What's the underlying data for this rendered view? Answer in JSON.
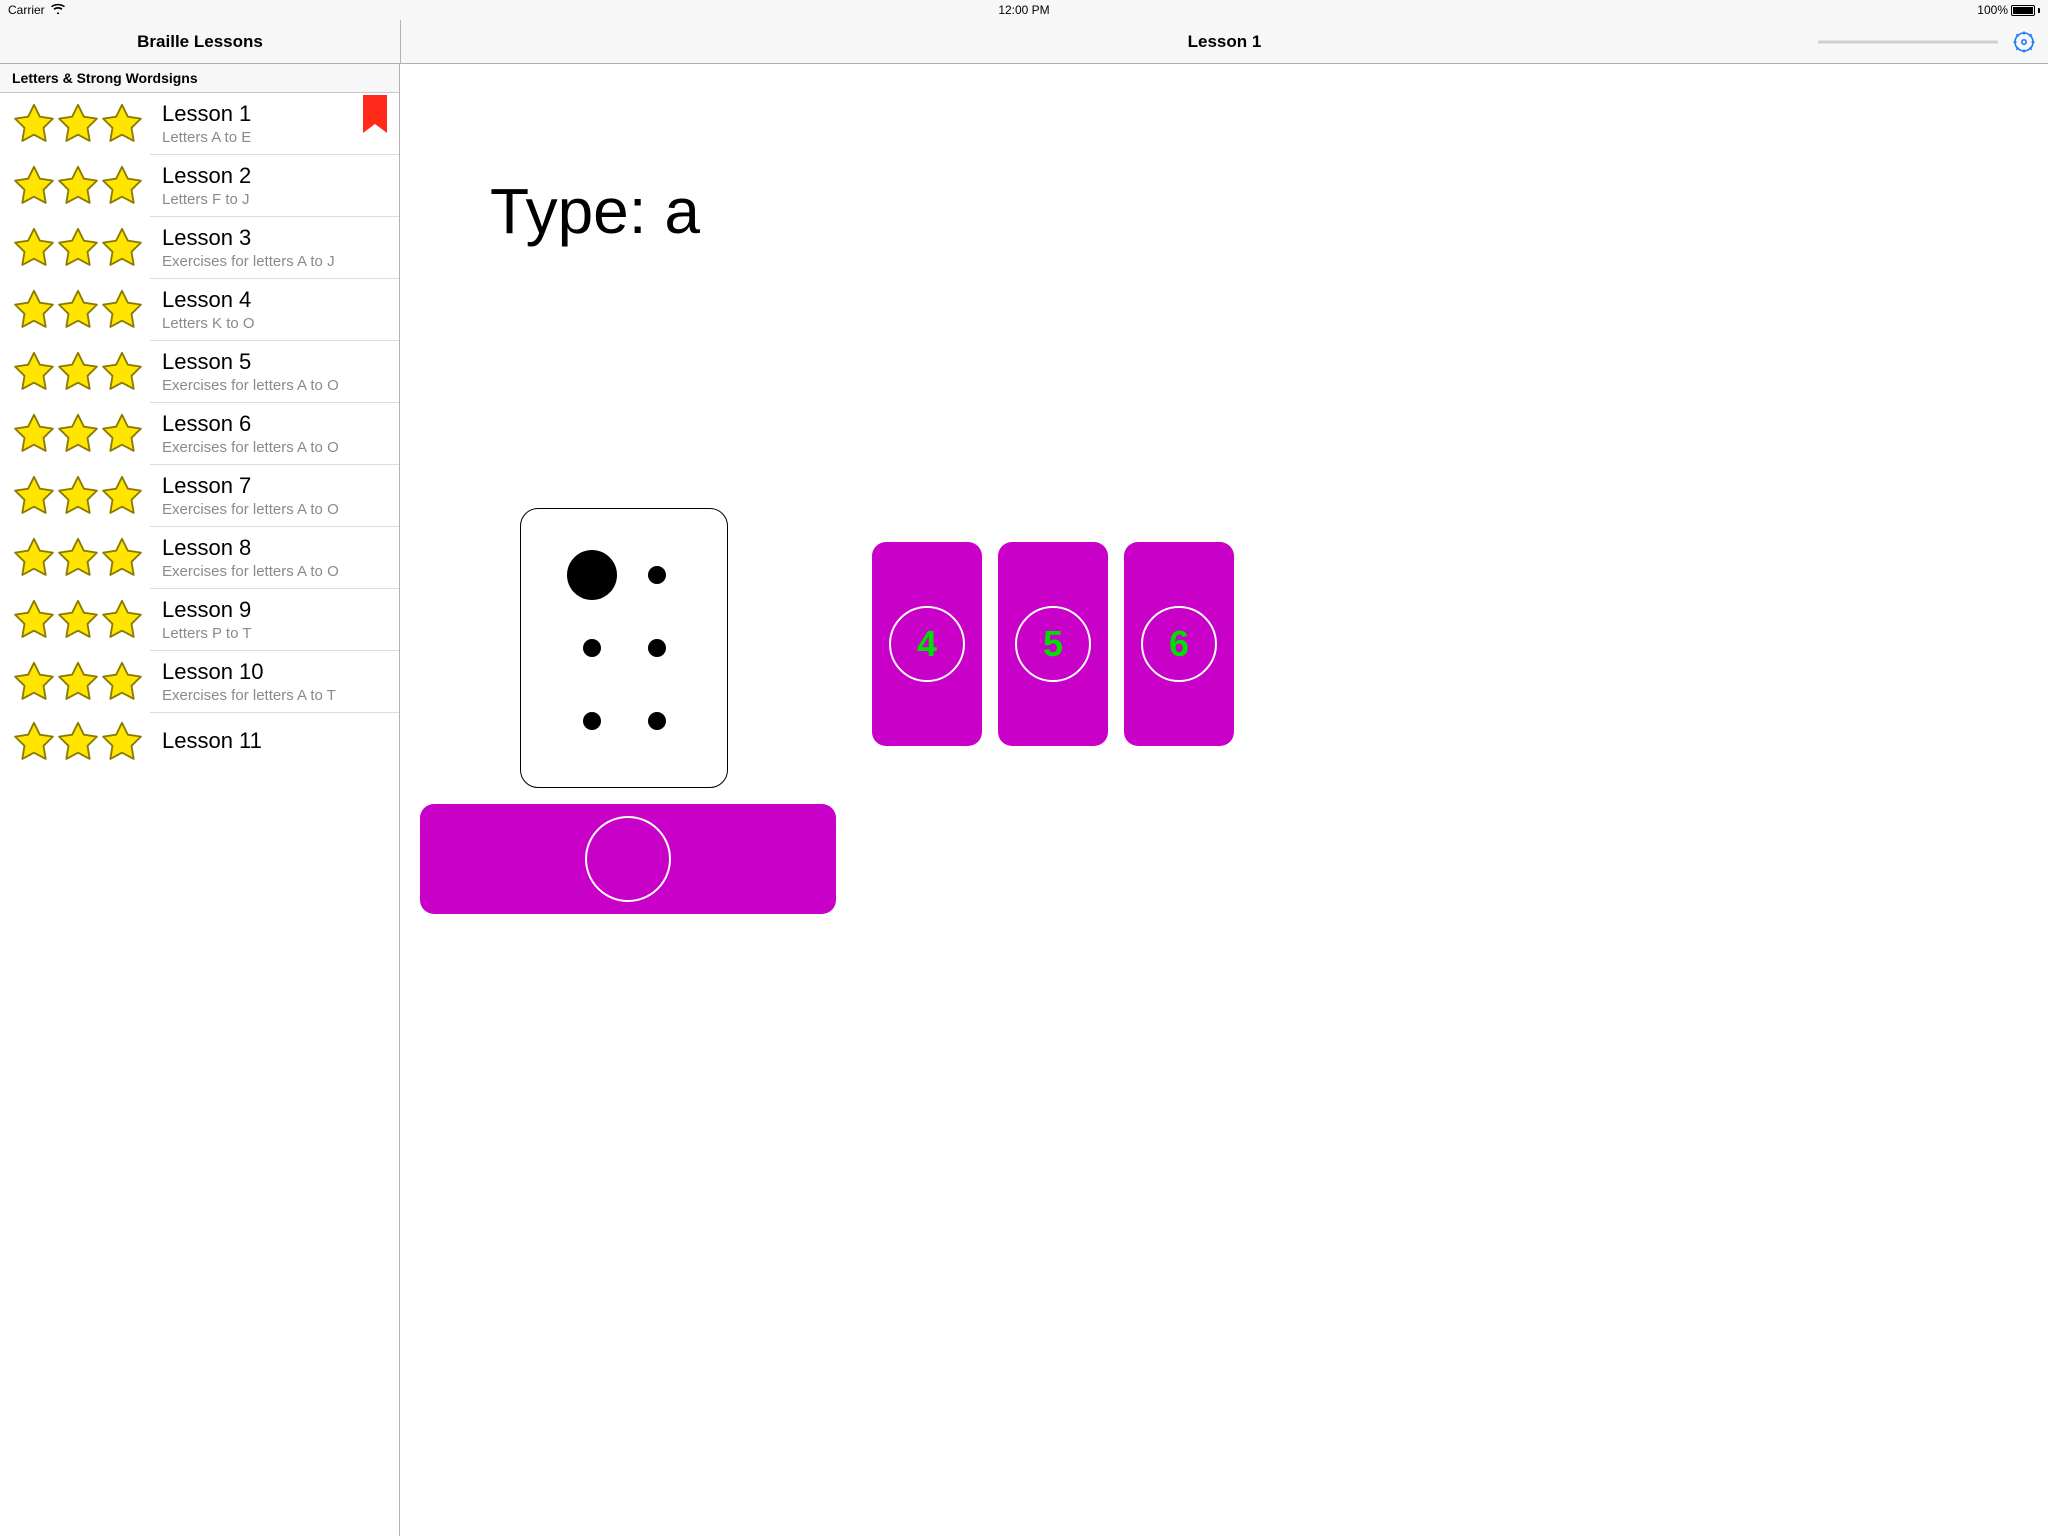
{
  "status": {
    "carrier": "Carrier",
    "time": "12:00 PM",
    "battery_pct": "100%"
  },
  "nav": {
    "sidebar_title": "Braille Lessons",
    "content_title": "Lesson 1"
  },
  "section_header": "Letters & Strong Wordsigns",
  "lessons": [
    {
      "title": "Lesson 1",
      "subtitle": "Letters A to E",
      "bookmark": true
    },
    {
      "title": "Lesson 2",
      "subtitle": "Letters F to J",
      "bookmark": false
    },
    {
      "title": "Lesson 3",
      "subtitle": "Exercises for letters A to J",
      "bookmark": false
    },
    {
      "title": "Lesson 4",
      "subtitle": "Letters K to O",
      "bookmark": false
    },
    {
      "title": "Lesson 5",
      "subtitle": "Exercises for letters A to O",
      "bookmark": false
    },
    {
      "title": "Lesson 6",
      "subtitle": "Exercises for letters A to O",
      "bookmark": false
    },
    {
      "title": "Lesson 7",
      "subtitle": "Exercises for letters A to O",
      "bookmark": false
    },
    {
      "title": "Lesson 8",
      "subtitle": "Exercises for letters A to O",
      "bookmark": false
    },
    {
      "title": "Lesson 9",
      "subtitle": "Letters P to T",
      "bookmark": false
    },
    {
      "title": "Lesson 10",
      "subtitle": "Exercises for letters A to T",
      "bookmark": false
    },
    {
      "title": "Lesson 11",
      "subtitle": "",
      "bookmark": false
    }
  ],
  "content": {
    "prompt": "Type: a",
    "braille_dots_raised": [
      true,
      false,
      false,
      false,
      false,
      false
    ],
    "key_labels": [
      "4",
      "5",
      "6"
    ]
  },
  "colors": {
    "key_bg": "#c800c8",
    "key_num": "#00e000",
    "star_fill": "#ffe500",
    "star_stroke": "#8a7a00",
    "bookmark": "#ff2a1a",
    "settings_icon": "#1e7cf2"
  }
}
